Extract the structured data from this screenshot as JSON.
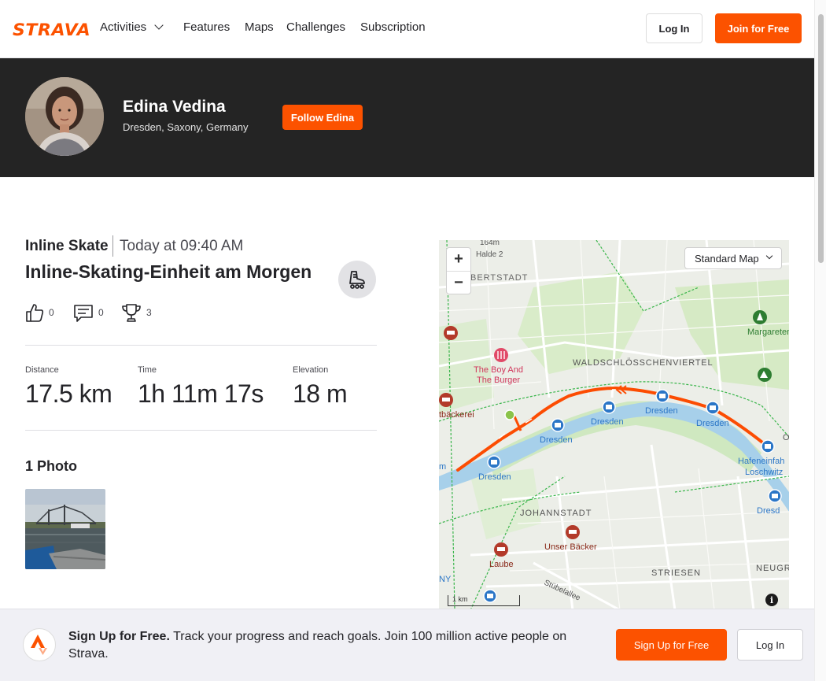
{
  "header": {
    "logo": "STRAVA",
    "nav": [
      "Activities",
      "Features",
      "Maps",
      "Challenges",
      "Subscription"
    ],
    "login": "Log In",
    "join": "Join for Free"
  },
  "athlete": {
    "name": "Edina Vedina",
    "location": "Dresden, Saxony, Germany",
    "follow": "Follow Edina"
  },
  "activity": {
    "type": "Inline Skate",
    "time": "Today at 09:40 AM",
    "title": "Inline-Skating-Einheit am Morgen",
    "kudos": "0",
    "comments": "0",
    "achievements": "3",
    "stats": [
      {
        "label": "Distance",
        "value": "17.5 km"
      },
      {
        "label": "Time",
        "value": "1h 11m 17s"
      },
      {
        "label": "Elevation",
        "value": "18 m"
      }
    ],
    "photos_title": "1 Photo"
  },
  "map": {
    "style": "Standard Map",
    "zoom_in": "+",
    "zoom_out": "−",
    "scale": "1 km",
    "info": "i",
    "labels": {
      "halde_elev": "164m",
      "halde": "Halde 2",
      "bertstadt": "BERTSTADT",
      "boy_burger_1": "The Boy And",
      "boy_burger_2": "The Burger",
      "waldschloss": "WALDSCHLÖSSCHENVIERTEL",
      "margaretenpark": "Margaretenpar",
      "baeckerei": "tbäckerei",
      "dresden": "Dresden",
      "hafen_1": "Hafeneinfah",
      "hafen_2": "Loschwitz",
      "johannstadt": "JOHANNSTADT",
      "unser_baecker": "Unser Bäcker",
      "laube": "Laube",
      "striesen": "STRIESEN",
      "stuebelallee": "Stübelallee",
      "neugr": "NEUGR",
      "ny": "NY",
      "m": "m",
      "o": "O",
      "dresd": "Dresd"
    }
  },
  "signup": {
    "headline": "Sign Up for Free.",
    "text": " Track your progress and reach goals. Join 100 million active people on Strava.",
    "button": "Sign Up for Free",
    "login": "Log In"
  },
  "colors": {
    "brand": "#fc5200",
    "banner": "#242424",
    "route": "#fc4c02",
    "water": "#a7d0ea"
  }
}
